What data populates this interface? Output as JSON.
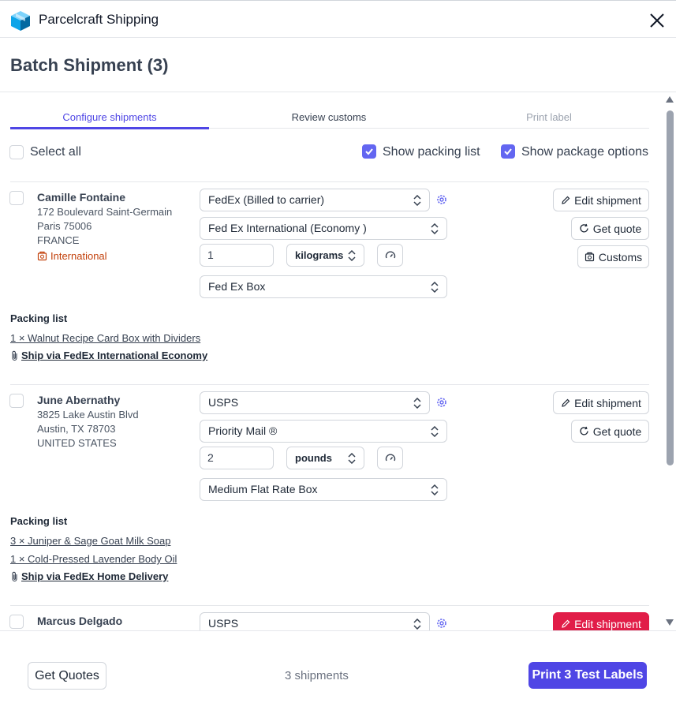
{
  "app": {
    "title": "Parcelcraft Shipping",
    "logo_icon": "box-icon",
    "close_icon": "close-icon"
  },
  "page": {
    "title": "Batch Shipment (3)"
  },
  "tabs": [
    {
      "label": "Configure shipments",
      "state": "active"
    },
    {
      "label": "Review customs",
      "state": "enabled"
    },
    {
      "label": "Print label",
      "state": "disabled"
    }
  ],
  "toolbar": {
    "select_all": {
      "label": "Select all",
      "checked": false
    },
    "show_packing_list": {
      "label": "Show packing list",
      "checked": true
    },
    "show_package_options": {
      "label": "Show package options",
      "checked": true
    }
  },
  "shipments": [
    {
      "name": "Camille Fontaine",
      "address_lines": [
        "172 Boulevard Saint-Germain",
        "Paris 75006",
        "FRANCE"
      ],
      "international_label": "International",
      "carrier": "FedEx (Billed to carrier)",
      "service": "Fed Ex International (Economy )",
      "weight": "1",
      "unit": "kilograms",
      "package": "Fed Ex Box",
      "buttons": {
        "edit": "Edit shipment",
        "quote": "Get quote",
        "customs": "Customs"
      },
      "packing_list_title": "Packing list",
      "items": [
        "1 × Walnut Recipe Card Box with Dividers"
      ],
      "ship_via": "Ship via FedEx International Economy"
    },
    {
      "name": "June Abernathy",
      "address_lines": [
        "3825 Lake Austin Blvd",
        "Austin, TX 78703",
        "UNITED STATES"
      ],
      "carrier": "USPS",
      "service": "Priority Mail ®",
      "weight": "2",
      "unit": "pounds",
      "package": "Medium Flat Rate Box",
      "buttons": {
        "edit": "Edit shipment",
        "quote": "Get quote"
      },
      "packing_list_title": "Packing list",
      "items": [
        "3 × Juniper & Sage Goat Milk Soap",
        "1 × Cold-Pressed Lavender Body Oil"
      ],
      "ship_via": "Ship via FedEx Home Delivery"
    },
    {
      "name": "Marcus Delgado",
      "carrier": "USPS",
      "buttons": {
        "edit": "Edit shipment"
      }
    }
  ],
  "footer": {
    "get_quotes": "Get Quotes",
    "count_text": "3 shipments",
    "print_button": "Print 3 Test Labels"
  },
  "colors": {
    "accent": "#4f46e5",
    "danger": "#e11d48",
    "international": "#c2410c"
  }
}
